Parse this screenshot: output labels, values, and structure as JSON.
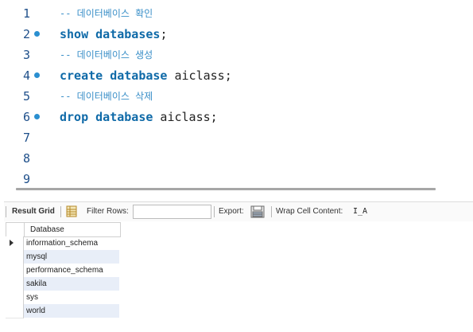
{
  "editor": {
    "lines": [
      {
        "num": "1",
        "marker": false,
        "comment": "-- 데이터베이스 확인"
      },
      {
        "num": "2",
        "marker": true,
        "kw1": "show",
        "kw2": "databases",
        "rest": ";"
      },
      {
        "num": "3",
        "marker": false,
        "comment": "-- 데이터베이스 생성"
      },
      {
        "num": "4",
        "marker": true,
        "kw1": "create",
        "kw2": "database",
        "rest": " aiclass;"
      },
      {
        "num": "5",
        "marker": false,
        "comment": "-- 데이터베이스 삭제"
      },
      {
        "num": "6",
        "marker": true,
        "kw1": "drop",
        "kw2": "database",
        "rest": " aiclass;"
      },
      {
        "num": "7",
        "marker": false
      },
      {
        "num": "8",
        "marker": false
      },
      {
        "num": "9",
        "marker": false
      }
    ]
  },
  "toolbar": {
    "result_grid": "Result Grid",
    "filter_rows": "Filter Rows:",
    "filter_value": "",
    "export": "Export:",
    "wrap_cell": "Wrap Cell Content:",
    "wrap_glyph": "I̲A"
  },
  "grid": {
    "column": "Database",
    "rows": [
      "information_schema",
      "mysql",
      "performance_schema",
      "sakila",
      "sys",
      "world"
    ]
  },
  "colors": {
    "keyword": "#0f6aa8",
    "comment": "#3a8fc8",
    "line_number": "#1e4f8a",
    "marker": "#2a8fd0",
    "alt_row": "#e8eef8"
  }
}
